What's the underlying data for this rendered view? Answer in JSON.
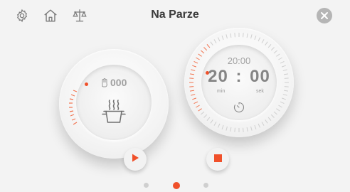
{
  "header": {
    "title": "Na Parze",
    "icons": [
      "gear-icon",
      "home-icon",
      "scale-icon",
      "close-icon"
    ]
  },
  "weight_dial": {
    "weight_value": "000",
    "icon": "weight-hand-icon",
    "program_icon": "steam-pot-icon"
  },
  "timer_dial": {
    "set_time": "20:00",
    "minutes": "20",
    "separator": ":",
    "seconds": "00",
    "min_label": "min",
    "sec_label": "sek",
    "icon": "timer-icon"
  },
  "controls": {
    "play_icon": "play-icon",
    "stop_icon": "stop-icon"
  },
  "pagination": {
    "count": 3,
    "active_index": 1
  },
  "colors": {
    "accent": "#f0502a",
    "background": "#f3f3f3",
    "text_dark": "#3a3a3a",
    "text_muted": "#9a9a9a"
  }
}
